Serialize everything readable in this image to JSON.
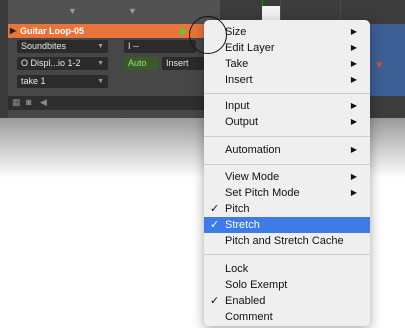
{
  "track": {
    "name": "Guitar Loop-05",
    "playlist": "Soundbites",
    "input": "I --",
    "output": "O Displ...io 1-2",
    "auto": "Auto",
    "insert": "Insert",
    "take": "take 1"
  },
  "menu": {
    "items": [
      {
        "label": "Size",
        "submenu": true
      },
      {
        "label": "Edit Layer",
        "submenu": true
      },
      {
        "label": "Take",
        "submenu": true
      },
      {
        "label": "Insert",
        "submenu": true
      },
      {
        "label": "Input",
        "submenu": true
      },
      {
        "label": "Output",
        "submenu": true
      },
      {
        "label": "Automation",
        "submenu": true
      },
      {
        "label": "View Mode",
        "submenu": true
      },
      {
        "label": "Set Pitch Mode",
        "submenu": true
      },
      {
        "label": "Pitch",
        "checked": true
      },
      {
        "label": "Stretch",
        "checked": true,
        "highlighted": true
      },
      {
        "label": "Pitch and Stretch Cache"
      },
      {
        "label": "Lock"
      },
      {
        "label": "Solo Exempt"
      },
      {
        "label": "Enabled",
        "checked": true
      },
      {
        "label": "Comment"
      }
    ]
  },
  "glyphs": {
    "check": "✓",
    "submenu": "▶",
    "dropdown": "▼",
    "play": "▶",
    "marker": "▼"
  },
  "colors": {
    "track_name_bg": "#e8743b",
    "highlight": "#3d7be8",
    "clip": "#3d5f96"
  }
}
